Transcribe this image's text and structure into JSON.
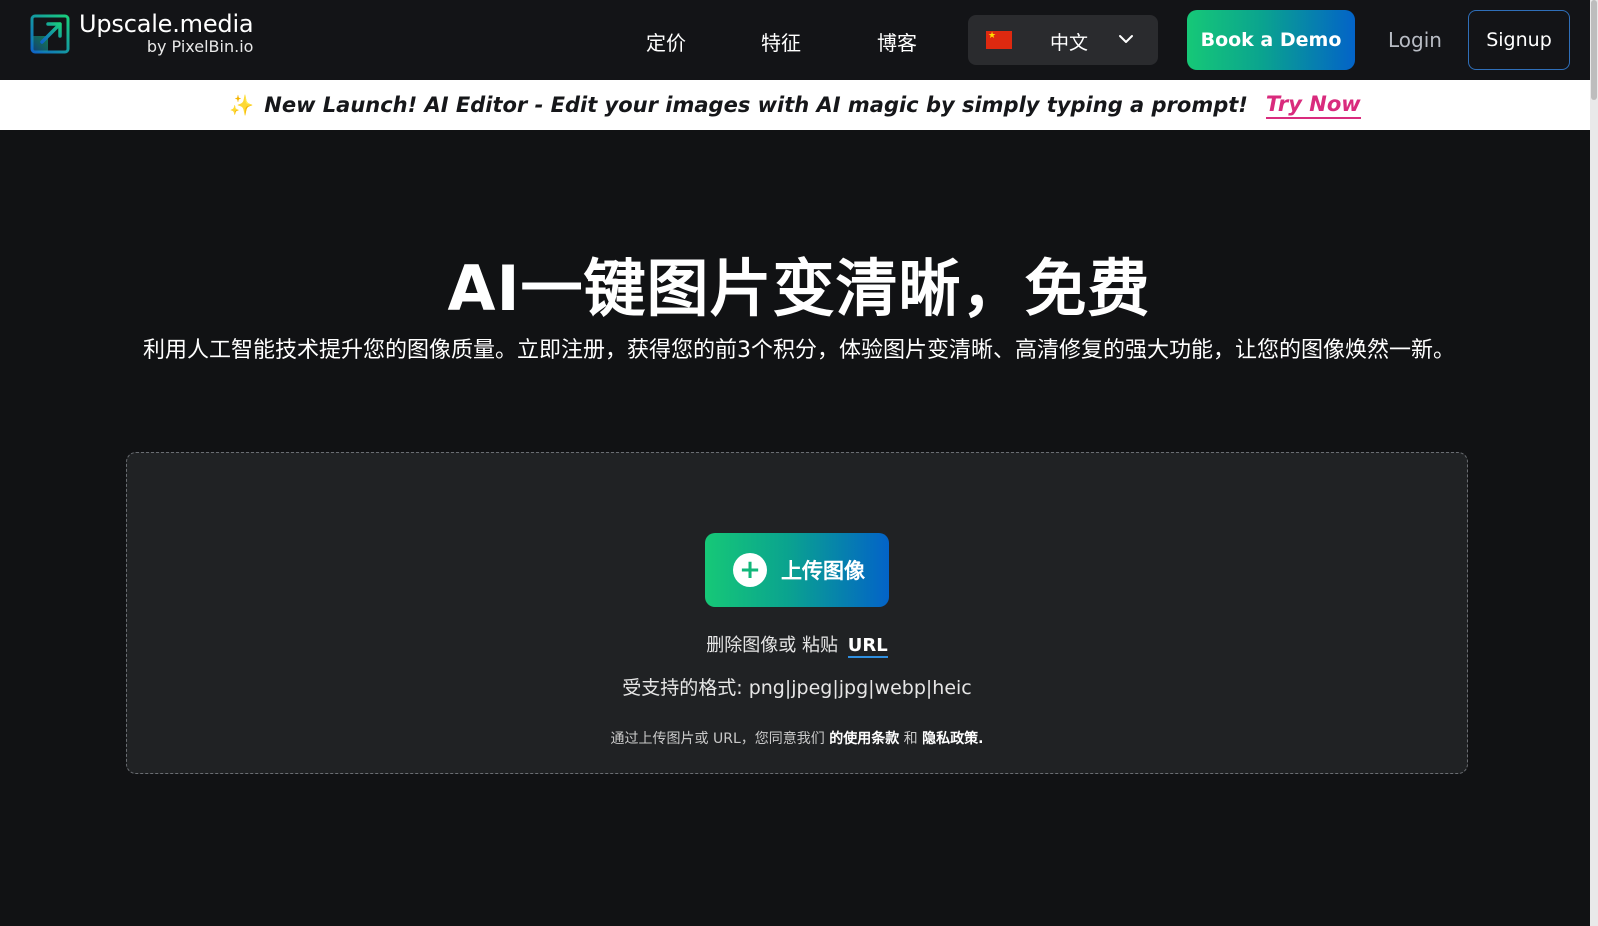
{
  "header": {
    "logo_main": "Upscale.media",
    "logo_sub": "by PixelBin.io",
    "nav": [
      {
        "label": "定价"
      },
      {
        "label": "特征"
      },
      {
        "label": "博客"
      }
    ],
    "language": {
      "label": "中文",
      "flag": "china-flag-icon"
    },
    "book_demo": "Book a Demo",
    "login": "Login",
    "signup": "Signup"
  },
  "announcement": {
    "icon": "sparkle-icon",
    "text": "New Launch! AI Editor - Edit your images with AI magic by simply typing a prompt!",
    "cta": "Try Now"
  },
  "hero": {
    "title": "AI一键图片变清晰，免费",
    "subtitle": "利用人工智能技术提升您的图像质量。立即注册，获得您的前3个积分，体验图片变清晰、高清修复的强大功能，让您的图像焕然一新。"
  },
  "upload": {
    "button": "上传图像",
    "drop_text": "删除图像或 粘贴",
    "url_label": "URL",
    "formats_prefix": "受支持的格式:",
    "formats": "png|jpeg|jpg|webp|heic",
    "legal_prefix": "通过上传图片或 URL，您同意我们",
    "terms": "的使用条款",
    "and": "和",
    "privacy": "隐私政策."
  },
  "colors": {
    "accent_gradient_start": "#16c877",
    "accent_gradient_end": "#0363c8",
    "try_now": "#d92b7d",
    "background": "#111214",
    "upload_box": "#202224"
  }
}
